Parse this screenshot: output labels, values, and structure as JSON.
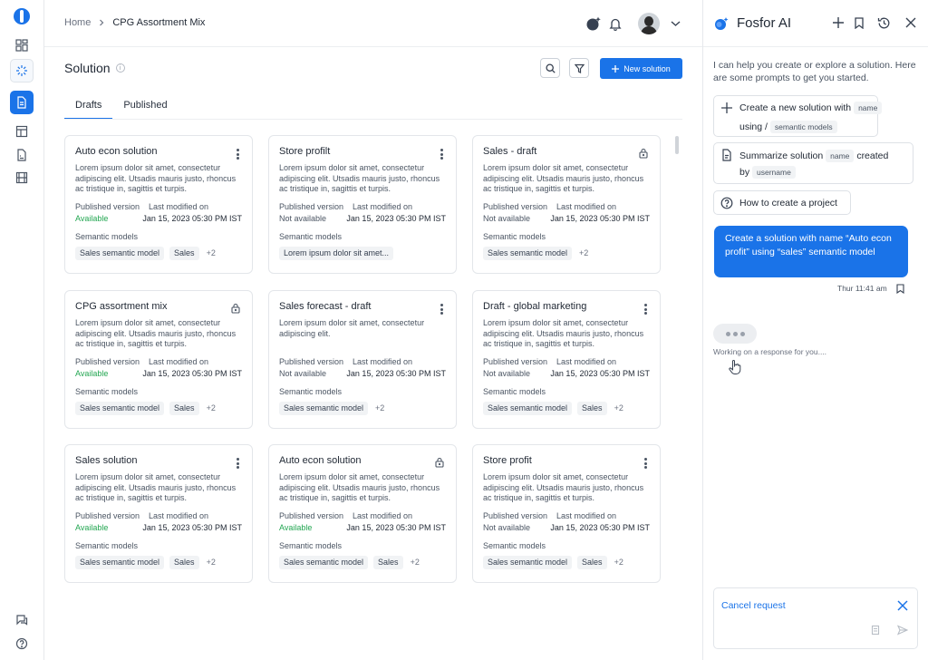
{
  "breadcrumb": {
    "home": "Home",
    "current": "CPG Assortment Mix"
  },
  "page": {
    "title": "Solution",
    "info": "i",
    "new_button": "New solution"
  },
  "tabs": [
    {
      "label": "Drafts",
      "active": true
    },
    {
      "label": "Published",
      "active": false
    }
  ],
  "card_labels": {
    "published_version": "Published version",
    "last_modified": "Last modified on",
    "semantic_models": "Semantic models"
  },
  "cards": [
    {
      "title": "Auto econ solution",
      "desc": "Lorem ipsum dolor sit amet, consectetur adipiscing elit. Utsadis mauris justo, rhoncus ac tristique in, sagittis et turpis.",
      "status": "Available",
      "date": "Jan 15, 2023 05:30 PM IST",
      "chips": [
        "Sales semantic model",
        "Sales"
      ],
      "more": "+2",
      "icon": "kebab"
    },
    {
      "title": "Store profilt",
      "desc": "Lorem ipsum dolor sit amet, consectetur adipiscing elit. Utsadis mauris justo, rhoncus ac tristique in, sagittis et turpis.",
      "status": "Not available",
      "date": "Jan 15, 2023 05:30 PM IST",
      "chips": [
        "Lorem ipsum dolor sit amet..."
      ],
      "more": "",
      "icon": "kebab"
    },
    {
      "title": "Sales - draft",
      "desc": "Lorem ipsum dolor sit amet, consectetur adipiscing elit. Utsadis mauris justo, rhoncus ac tristique in, sagittis et turpis.",
      "status": "Not available",
      "date": "Jan 15, 2023 05:30 PM IST",
      "chips": [
        "Sales semantic model"
      ],
      "more": "+2",
      "icon": "lock"
    },
    {
      "title": "CPG assortment mix",
      "desc": "Lorem ipsum dolor sit amet, consectetur adipiscing elit. Utsadis mauris justo, rhoncus ac tristique in, sagittis et turpis.",
      "status": "Available",
      "date": "Jan 15, 2023 05:30 PM IST",
      "chips": [
        "Sales semantic model",
        "Sales"
      ],
      "more": "+2",
      "icon": "lock"
    },
    {
      "title": "Sales forecast - draft",
      "desc": "Lorem ipsum dolor sit amet, consectetur adipiscing elit.",
      "status": "Not available",
      "date": "Jan 15, 2023 05:30 PM IST",
      "chips": [
        "Sales semantic model"
      ],
      "more": "+2",
      "icon": "kebab"
    },
    {
      "title": "Draft - global marketing",
      "desc": "Lorem ipsum dolor sit amet, consectetur adipiscing elit. Utsadis mauris justo, rhoncus ac tristique in, sagittis et turpis.",
      "status": "Not available",
      "date": "Jan 15, 2023 05:30 PM IST",
      "chips": [
        "Sales semantic model",
        "Sales"
      ],
      "more": "+2",
      "icon": "kebab"
    },
    {
      "title": "Sales solution",
      "desc": "Lorem ipsum dolor sit amet, consectetur adipiscing elit. Utsadis mauris justo, rhoncus ac tristique in, sagittis et turpis.",
      "status": "Available",
      "date": "Jan 15, 2023 05:30 PM IST",
      "chips": [
        "Sales semantic model",
        "Sales"
      ],
      "more": "+2",
      "icon": "kebab"
    },
    {
      "title": "Auto econ solution",
      "desc": "Lorem ipsum dolor sit amet, consectetur adipiscing elit. Utsadis mauris justo, rhoncus ac tristique in, sagittis et turpis.",
      "status": "Available",
      "date": "Jan 15, 2023 05:30 PM IST",
      "chips": [
        "Sales semantic model",
        "Sales"
      ],
      "more": "+2",
      "icon": "lock"
    },
    {
      "title": "Store profit",
      "desc": "Lorem ipsum dolor sit amet, consectetur adipiscing elit. Utsadis mauris justo, rhoncus ac tristique in, sagittis et turpis.",
      "status": "Not available",
      "date": "Jan 15, 2023 05:30 PM IST",
      "chips": [
        "Sales semantic model",
        "Sales"
      ],
      "more": "+2",
      "icon": "kebab"
    }
  ],
  "assistant": {
    "title": "Fosfor AI",
    "intro": "I can help you create or explore a solution. Here are some prompts to get you started.",
    "prompt1": {
      "text_a": "Create a new solution with",
      "tag_a": "name",
      "text_b": "using /",
      "tag_b": "semantic models"
    },
    "prompt2": {
      "text_a": "Summarize solution",
      "tag_a": "name",
      "text_b": "created",
      "text_c": "by",
      "tag_b": "username"
    },
    "prompt3": {
      "text": "How to create a project"
    },
    "user_message": "Create a solution with name “Auto econ profit” using “sales” semantic model",
    "timestamp": "Thur 11:41 am",
    "working": "Working on a response for you....",
    "cancel": "Cancel request"
  },
  "colors": {
    "accent": "#1a73e8",
    "available": "#22a651",
    "border": "#e3e6ea"
  }
}
